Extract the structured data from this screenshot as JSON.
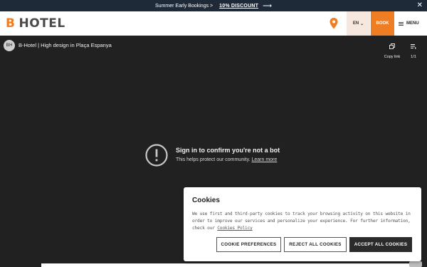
{
  "promo": {
    "text": "Summer Early Bookings >",
    "link": "10% DISCOUNT",
    "arrow": "⟶",
    "close": "✕"
  },
  "header": {
    "logo_b": "B",
    "logo_text": "HOTEL",
    "lang": "EN",
    "lang_chevron": "⌄",
    "book": "BOOK",
    "menu": "MENU",
    "brand_color": "#ef7d23"
  },
  "video": {
    "channel_initials": "BH",
    "title": "B-Hotel | High design in Plaça Espanya",
    "copy_link": "Copy link",
    "playlist_count": "1/1",
    "bot_title": "Sign in to confirm you're not a bot",
    "bot_sub": "This helps protect our community.",
    "learn_more": "Learn more"
  },
  "cookies": {
    "title": "Cookies",
    "text": "We use first and third-party cookies to track your browsing activity on this website in order to improve our services and personalize your experience. For further information, check our",
    "policy_link": "Cookies Policy",
    "pref_button": "COOKIE PREFERENCES",
    "reject_button": "REJECT ALL COOKIES",
    "accept_button": "ACCEPT ALL COOKIES"
  }
}
